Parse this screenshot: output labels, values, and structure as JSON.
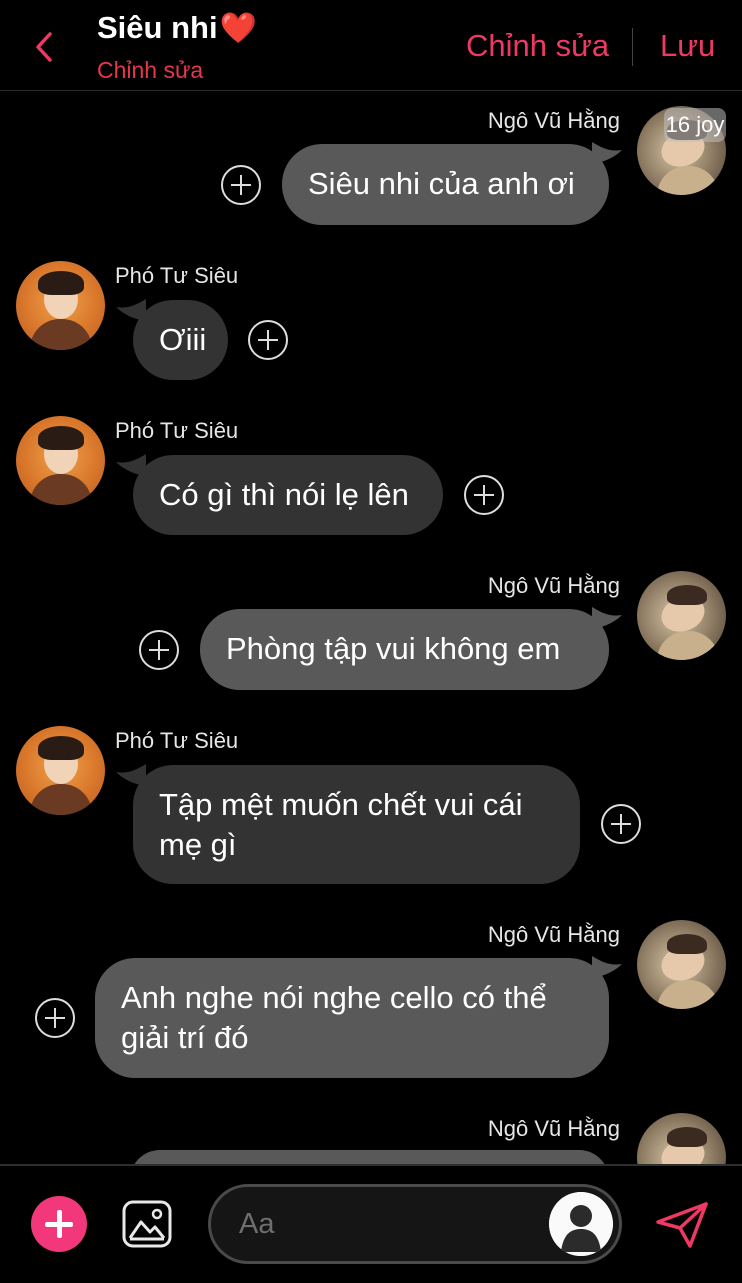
{
  "header": {
    "title": "Siêu nhi",
    "heart": "❤️",
    "subtitle": "Chỉnh sửa",
    "edit_label": "Chỉnh sửa",
    "save_label": "Lưu",
    "accent": "#ee3a63"
  },
  "badge": "16 joy",
  "messages": [
    {
      "sender": "Ngô Vũ Hằng",
      "text": "Siêu nhi của anh ơi",
      "side": "right"
    },
    {
      "sender": "Phó Tư Siêu",
      "text": "Ơiii",
      "side": "left"
    },
    {
      "sender": "Phó Tư Siêu",
      "text": "Có gì thì nói lẹ lên",
      "side": "left"
    },
    {
      "sender": "Ngô Vũ Hằng",
      "text": "Phòng tập vui không em",
      "side": "right"
    },
    {
      "sender": "Phó Tư Siêu",
      "text": "Tập mệt muốn chết vui cái mẹ gì",
      "side": "left"
    },
    {
      "sender": "Ngô Vũ Hằng",
      "text": "Anh nghe nói nghe cello có thể giải trí đó",
      "side": "right"
    },
    {
      "sender": "Ngô Vũ Hằng",
      "text": "",
      "side": "right"
    }
  ],
  "composer": {
    "placeholder": "Aa",
    "add_icon": "plus-icon",
    "image_icon": "image-icon",
    "send_icon": "send-icon"
  }
}
